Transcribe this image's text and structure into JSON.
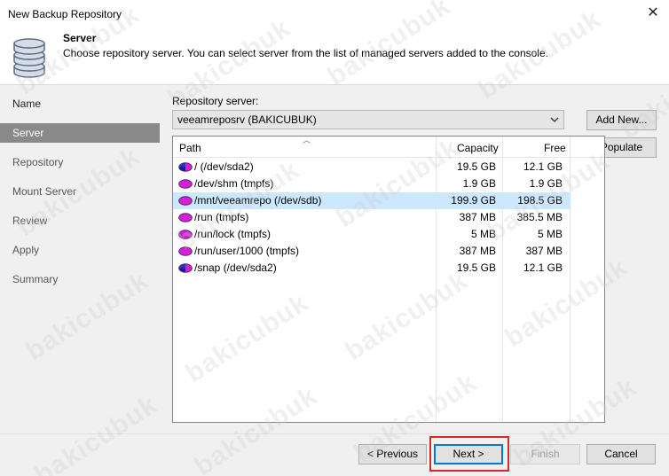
{
  "window": {
    "title": "New Backup Repository",
    "close_glyph": "✕"
  },
  "header": {
    "icon": "database-icon",
    "title": "Server",
    "description": "Choose repository server. You can select server from the list of managed servers added to the console."
  },
  "nav": {
    "items": [
      {
        "label": "Name",
        "state": "done"
      },
      {
        "label": "Server",
        "state": "active"
      },
      {
        "label": "Repository",
        "state": "pending"
      },
      {
        "label": "Mount Server",
        "state": "pending"
      },
      {
        "label": "Review",
        "state": "pending"
      },
      {
        "label": "Apply",
        "state": "pending"
      },
      {
        "label": "Summary",
        "state": "pending"
      }
    ]
  },
  "main": {
    "server_label": "Repository server:",
    "server_value": "veeamreposrv (BAKICUBUK)",
    "add_new_label": "Add New...",
    "populate_label": "Populate",
    "table": {
      "columns": [
        "Path",
        "Capacity",
        "Free"
      ],
      "rows": [
        {
          "path": "/ (/dev/sda2)",
          "capacity": "19.5 GB",
          "free": "12.1 GB",
          "icon": "system-disk-icon",
          "selected": false
        },
        {
          "path": "/dev/shm (tmpfs)",
          "capacity": "1.9 GB",
          "free": "1.9 GB",
          "icon": "disk-icon",
          "selected": false
        },
        {
          "path": "/mnt/veeamrepo (/dev/sdb)",
          "capacity": "199.9 GB",
          "free": "198.5 GB",
          "icon": "disk-icon",
          "selected": true
        },
        {
          "path": "/run (tmpfs)",
          "capacity": "387 MB",
          "free": "385.5 MB",
          "icon": "disk-icon",
          "selected": false
        },
        {
          "path": "/run/lock (tmpfs)",
          "capacity": "5 MB",
          "free": "5 MB",
          "icon": "disk-icon",
          "selected": false
        },
        {
          "path": "/run/user/1000 (tmpfs)",
          "capacity": "387 MB",
          "free": "387 MB",
          "icon": "disk-icon",
          "selected": false
        },
        {
          "path": "/snap (/dev/sda2)",
          "capacity": "19.5 GB",
          "free": "12.1 GB",
          "icon": "system-disk-icon",
          "selected": false
        }
      ]
    }
  },
  "footer": {
    "previous_label": "< Previous",
    "next_label": "Next >",
    "finish_label": "Finish",
    "cancel_label": "Cancel"
  },
  "watermark": "bakicubuk",
  "colors": {
    "nav_active": "#898989",
    "selected_row": "#cce8ff",
    "disk_fill": "#d61fd6",
    "highlight": "#d9282a"
  }
}
